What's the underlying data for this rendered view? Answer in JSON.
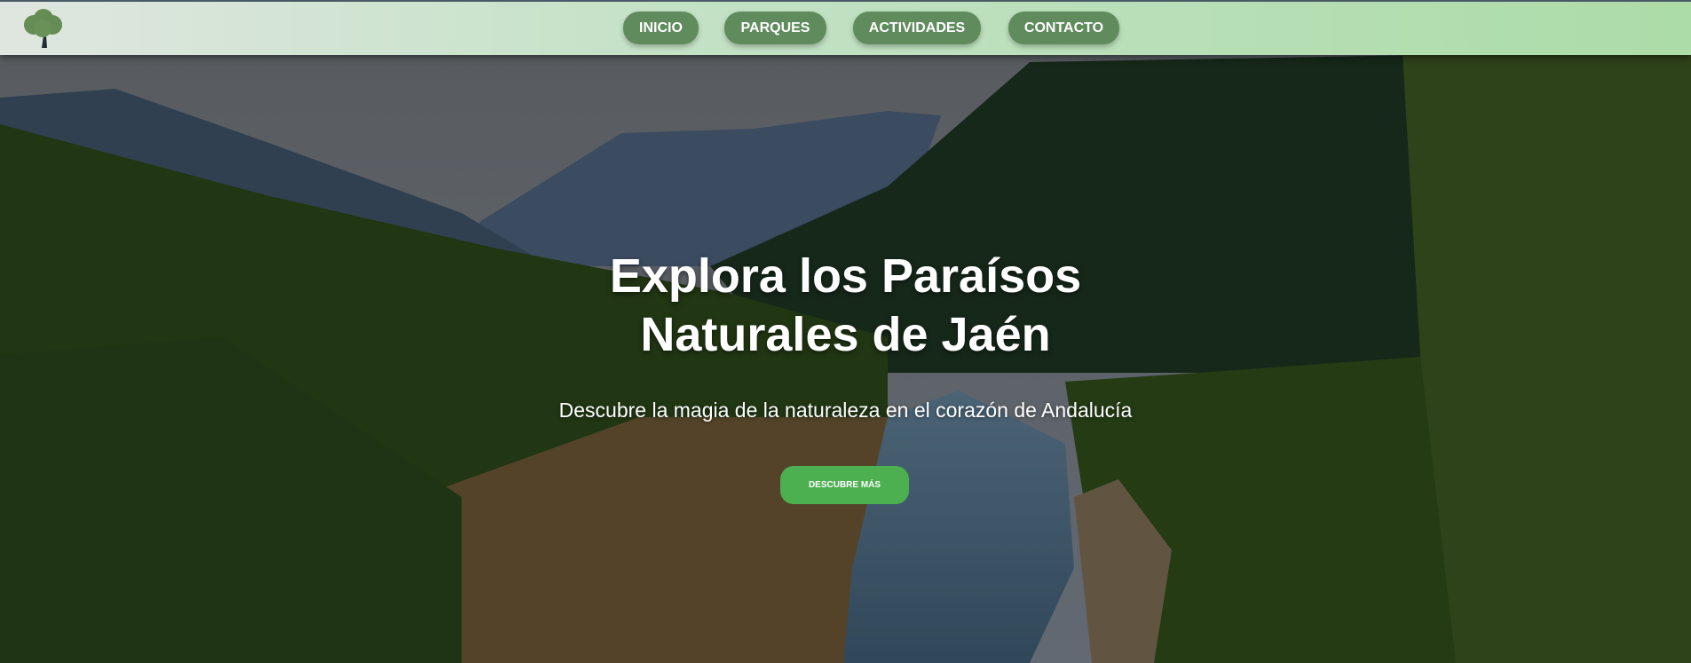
{
  "nav": {
    "logo": "tree-logo",
    "items": [
      {
        "label": "INICIO"
      },
      {
        "label": "PARQUES"
      },
      {
        "label": "ACTIVIDADES"
      },
      {
        "label": "CONTACTO"
      }
    ]
  },
  "hero": {
    "title_line1": "Explora los Paraísos",
    "title_line2": "Naturales de Jaén",
    "subtitle": "Descubre la magia de la naturaleza en el corazón de Andalucía",
    "cta_label": "DESCUBRE MÁS"
  },
  "colors": {
    "nav_button": "#5f8b5d",
    "cta": "#4caf50"
  }
}
